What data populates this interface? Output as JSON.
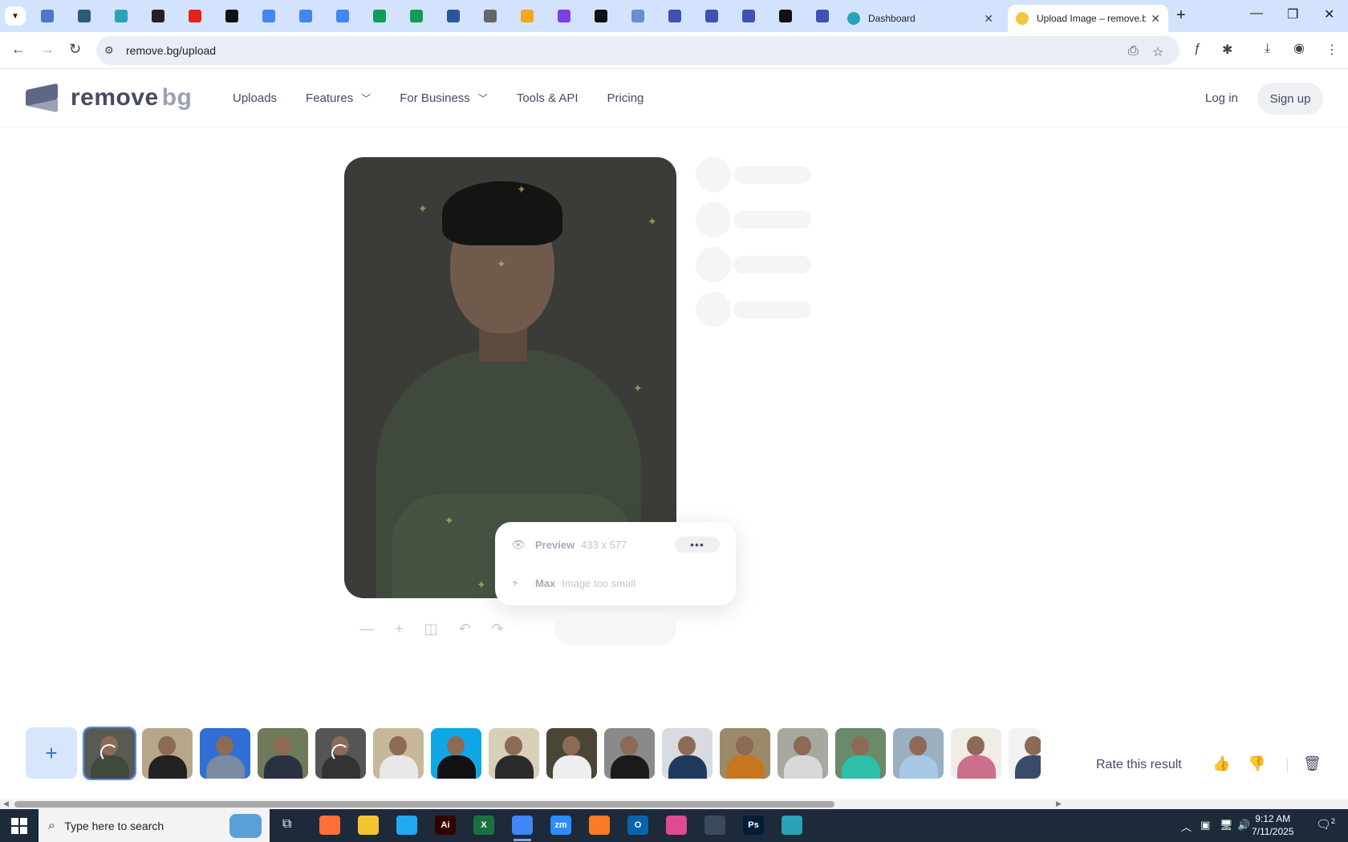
{
  "browser": {
    "pinned_tabs": [
      {
        "icon": "half-circle-icon",
        "color": "#4a79c7"
      },
      {
        "icon": "shield-v-icon",
        "color": "#2b5b7a"
      },
      {
        "icon": "hexagon-icon",
        "color": "#2aa3b8"
      },
      {
        "icon": "openai-icon",
        "color": "#222222"
      },
      {
        "icon": "youtube-icon",
        "color": "#e62117"
      },
      {
        "icon": "bolt-icon",
        "color": "#111111"
      },
      {
        "icon": "docs-icon",
        "color": "#4285f4"
      },
      {
        "icon": "docs-icon",
        "color": "#4285f4"
      },
      {
        "icon": "docs-icon",
        "color": "#4285f4"
      },
      {
        "icon": "sheets-icon",
        "color": "#0f9d58"
      },
      {
        "icon": "sheets-icon",
        "color": "#0f9d58"
      },
      {
        "icon": "word-icon",
        "color": "#2b579a"
      },
      {
        "icon": "globe-icon",
        "color": "#666666"
      },
      {
        "icon": "crown-icon",
        "color": "#f5a623"
      },
      {
        "icon": "braces-icon",
        "color": "#7b3fe4"
      },
      {
        "icon": "ai-icon",
        "color": "#111111"
      },
      {
        "icon": "grid-icon",
        "color": "#6b8cce"
      },
      {
        "icon": "forms-icon",
        "color": "#3f51b5"
      },
      {
        "icon": "forms-icon",
        "color": "#3f51b5"
      },
      {
        "icon": "forms-icon",
        "color": "#3f51b5"
      },
      {
        "icon": "medium-icon",
        "color": "#111111"
      },
      {
        "icon": "forms-icon",
        "color": "#3f51b5"
      }
    ],
    "tabs": [
      {
        "title": "Dashboard",
        "active": false,
        "icon_color": "#2aa3b8"
      },
      {
        "title": "Upload Image – remove.bg",
        "active": true,
        "icon_color": "#f5c542"
      }
    ],
    "url": "remove.bg/upload"
  },
  "site": {
    "logo_main": "remove",
    "logo_accent": "bg",
    "nav": [
      "Uploads",
      "Features",
      "For Business",
      "Tools & API",
      "Pricing"
    ],
    "login": "Log in",
    "signup": "Sign up"
  },
  "download_card": {
    "preview_label": "Preview",
    "preview_size": "433 x 577",
    "max_label": "Max",
    "max_note": "Image too small"
  },
  "thumbnails": [
    {
      "bg": "#5a5a55",
      "body": "#3f4a3c",
      "loading": true,
      "selected": true
    },
    {
      "bg": "#b7a78a",
      "body": "#222222"
    },
    {
      "bg": "#2f6fd6",
      "body": "#7a8aa0"
    },
    {
      "bg": "#6f7a5a",
      "body": "#2a3140"
    },
    {
      "bg": "#555555",
      "body": "#333333",
      "loading": true
    },
    {
      "bg": "#c7b89a",
      "body": "#e8e8e8"
    },
    {
      "bg": "#10a7e8",
      "body": "#111111"
    },
    {
      "bg": "#d8cfb8",
      "body": "#2a2a2a"
    },
    {
      "bg": "#4a4535",
      "body": "#eeeeee"
    },
    {
      "bg": "#8a8a8a",
      "body": "#1a1a1a"
    },
    {
      "bg": "#d8dce0",
      "body": "#1f3a5c"
    },
    {
      "bg": "#9a8a6a",
      "body": "#c9741f"
    },
    {
      "bg": "#a8a8a0",
      "body": "#d8d8d8"
    },
    {
      "bg": "#6a8a6a",
      "body": "#2dbfa8"
    },
    {
      "bg": "#9ab0c0",
      "body": "#a8c8e8"
    },
    {
      "bg": "#f0ece8",
      "body": "#cc6f8a"
    },
    {
      "bg": "#f2f2f2",
      "body": "#3a4a6a"
    }
  ],
  "rate": {
    "label": "Rate this result"
  },
  "taskbar": {
    "search_placeholder": "Type here to search",
    "apps": [
      {
        "label": "",
        "color": "#ff7139",
        "icon": "firefox-icon"
      },
      {
        "label": "",
        "color": "#f4c430",
        "icon": "folder-icon"
      },
      {
        "label": "",
        "color": "#23a9f2",
        "icon": "vscode-icon"
      },
      {
        "label": "Ai",
        "color": "#330000",
        "icon": "illustrator-icon"
      },
      {
        "label": "X",
        "color": "#1d6f42",
        "icon": "excel-icon"
      },
      {
        "label": "",
        "color": "#4285f4",
        "icon": "chrome-icon",
        "active": true
      },
      {
        "label": "zm",
        "color": "#2d8cff",
        "icon": "zoom-icon"
      },
      {
        "label": "",
        "color": "#fb7a24",
        "icon": "xampp-icon"
      },
      {
        "label": "O",
        "color": "#0a64ad",
        "icon": "outlook-icon"
      },
      {
        "label": "",
        "color": "#e04b8f",
        "icon": "capcut-icon"
      },
      {
        "label": "",
        "color": "#3a4a5a",
        "icon": "pen-icon"
      },
      {
        "label": "Ps",
        "color": "#001e36",
        "icon": "photoshop-icon"
      },
      {
        "label": "",
        "color": "#2aa3b8",
        "icon": "hexagon-app-icon"
      }
    ],
    "time": "9:12 AM",
    "date": "7/11/2025",
    "notifications": "2"
  }
}
